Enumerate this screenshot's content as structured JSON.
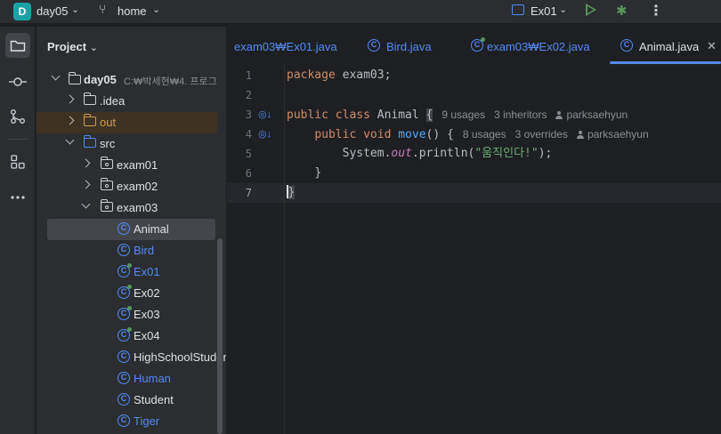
{
  "titlebar": {
    "project_badge": "D",
    "project_name": "day05",
    "branch_icon": "git-branch-icon",
    "branch_name": "home",
    "run_config": "Ex01"
  },
  "activity_bar": {
    "items": [
      "folder-icon",
      "commit-icon",
      "structure-icon",
      "plugins-icon",
      "more-icon"
    ]
  },
  "project_panel": {
    "title": "Project",
    "tree": [
      {
        "label": "day05",
        "path": "C:₩박세현₩4. 프로그",
        "type": "module"
      },
      {
        "label": ".idea",
        "type": "folder"
      },
      {
        "label": "out",
        "type": "folder-excluded"
      },
      {
        "label": "src",
        "type": "folder-source"
      },
      {
        "label": "exam01",
        "type": "package"
      },
      {
        "label": "exam02",
        "type": "package"
      },
      {
        "label": "exam03",
        "type": "package"
      },
      {
        "label": "Animal",
        "type": "class"
      },
      {
        "label": "Bird",
        "type": "class"
      },
      {
        "label": "Ex01",
        "type": "main-class"
      },
      {
        "label": "Ex02",
        "type": "main-class"
      },
      {
        "label": "Ex03",
        "type": "main-class"
      },
      {
        "label": "Ex04",
        "type": "main-class"
      },
      {
        "label": "HighSchoolStuden",
        "type": "class"
      },
      {
        "label": "Human",
        "type": "class"
      },
      {
        "label": "Student",
        "type": "class"
      },
      {
        "label": "Tiger",
        "type": "class"
      }
    ]
  },
  "editor": {
    "tabs": [
      {
        "label": "exam03₩Ex01.java",
        "active": false
      },
      {
        "label": "Bird.java",
        "active": false
      },
      {
        "label": "exam03₩Ex02.java",
        "active": false
      },
      {
        "label": "Animal.java",
        "active": true
      }
    ],
    "line_numbers": [
      "1",
      "2",
      "3",
      "4",
      "5",
      "6",
      "7"
    ],
    "code": {
      "l1_kw": "package",
      "l1_rest": " exam03;",
      "l3_kw": "public class",
      "l3_name": " Animal ",
      "l3_brace": "{",
      "l3_hint_usages": "9 usages",
      "l3_hint_inheritors": "3 inheritors",
      "l3_hint_author": "parksaehyun",
      "l4_kw": "public void",
      "l4_name": "move",
      "l4_rest": "() {",
      "l4_hint_usages": "8 usages",
      "l4_hint_overrides": "3 overrides",
      "l4_hint_author": "parksaehyun",
      "l5_sys": "System.",
      "l5_out": "out",
      "l5_call": ".println(",
      "l5_str": "\"움직인다!\"",
      "l5_end": ");",
      "l6": "}",
      "l7": "}"
    }
  },
  "colors": {
    "accent": "#548af7",
    "keyword": "#cf8e6d",
    "string": "#6aab73",
    "run": "#57965c"
  }
}
